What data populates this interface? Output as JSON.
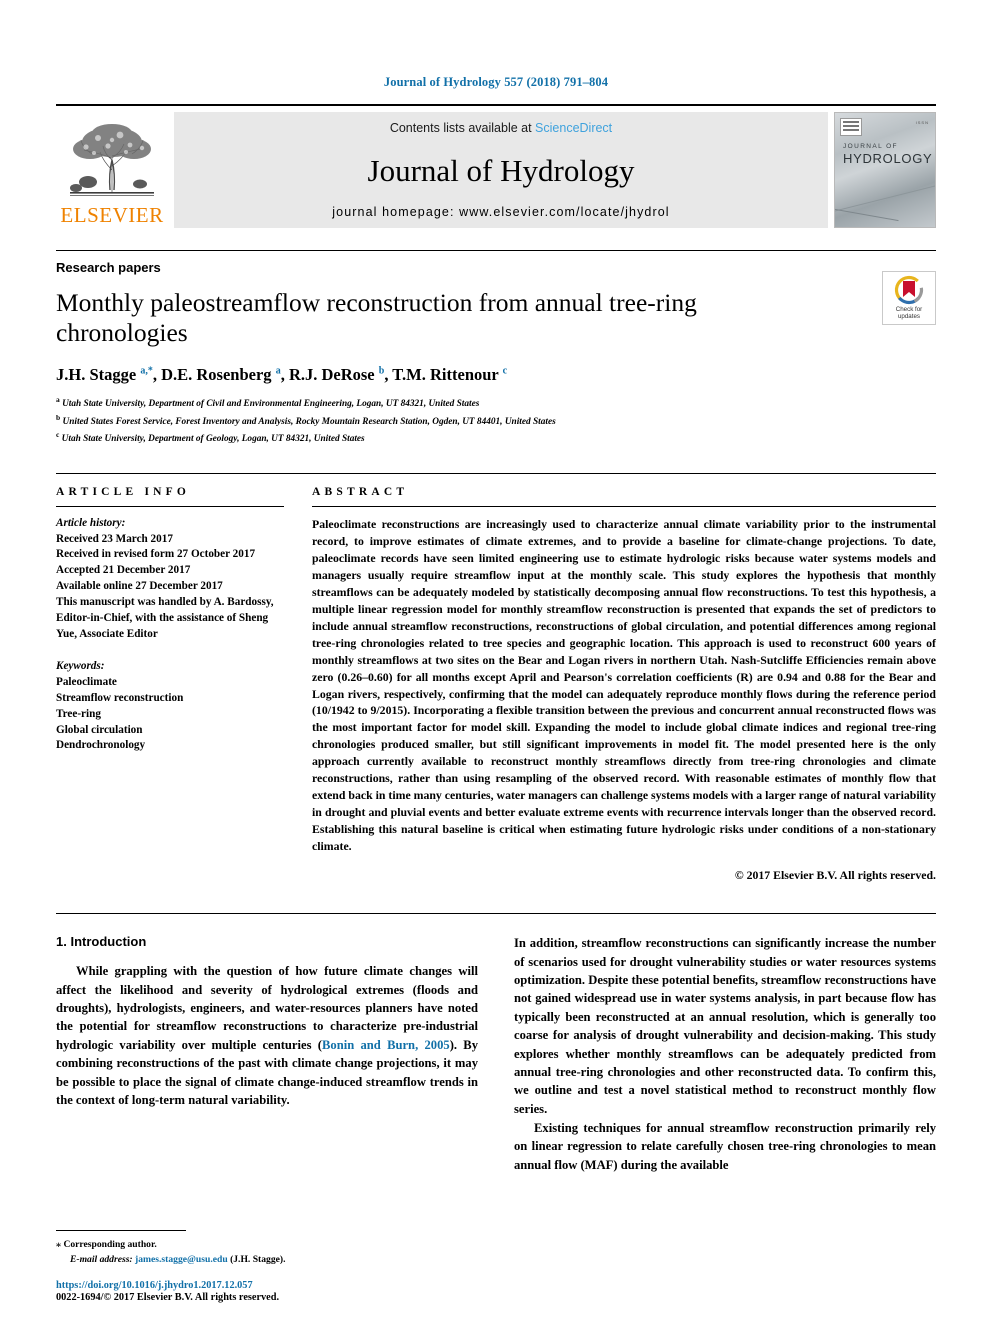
{
  "running_head": "Journal of Hydrology 557 (2018) 791–804",
  "masthead": {
    "publisher_name": "ELSEVIER",
    "contents_prefix": "Contents lists available at ",
    "contents_link": "ScienceDirect",
    "journal_title": "Journal of Hydrology",
    "homepage": "journal homepage: www.elsevier.com/locate/jhydrol",
    "cover": {
      "line1": "JOURNAL OF",
      "line2": "HYDROLOGY",
      "code": "ISSN"
    }
  },
  "article": {
    "kicker": "Research papers",
    "title": "Monthly paleostreamflow reconstruction from annual tree-ring chronologies",
    "authors_html": "J.H. Stagge <sup>a,*</sup>, D.E. Rosenberg <sup>a</sup>, R.J. DeRose <sup>b</sup>, T.M. Rittenour <sup>c</sup>",
    "affiliations": [
      {
        "marker": "a",
        "text": "Utah State University, Department of Civil and Environmental Engineering, Logan, UT 84321, United States"
      },
      {
        "marker": "b",
        "text": "United States Forest Service, Forest Inventory and Analysis, Rocky Mountain Research Station, Ogden, UT 84401, United States"
      },
      {
        "marker": "c",
        "text": "Utah State University, Department of Geology, Logan, UT 84321, United States"
      }
    ],
    "crossmark": {
      "line1": "Check for",
      "line2": "updates"
    }
  },
  "article_info": {
    "heading": "ARTICLE INFO",
    "history_label": "Article history:",
    "history": [
      "Received 23 March 2017",
      "Received in revised form 27 October 2017",
      "Accepted 21 December 2017",
      "Available online 27 December 2017",
      "This manuscript was handled by A. Bardossy, Editor-in-Chief, with the assistance of Sheng Yue, Associate Editor"
    ],
    "keywords_label": "Keywords:",
    "keywords": [
      "Paleoclimate",
      "Streamflow reconstruction",
      "Tree-ring",
      "Global circulation",
      "Dendrochronology"
    ]
  },
  "abstract": {
    "heading": "ABSTRACT",
    "text": "Paleoclimate reconstructions are increasingly used to characterize annual climate variability prior to the instrumental record, to improve estimates of climate extremes, and to provide a baseline for climate-change projections. To date, paleoclimate records have seen limited engineering use to estimate hydrologic risks because water systems models and managers usually require streamflow input at the monthly scale. This study explores the hypothesis that monthly streamflows can be adequately modeled by statistically decomposing annual flow reconstructions. To test this hypothesis, a multiple linear regression model for monthly streamflow reconstruction is presented that expands the set of predictors to include annual streamflow reconstructions, reconstructions of global circulation, and potential differences among regional tree-ring chronologies related to tree species and geographic location. This approach is used to reconstruct 600 years of monthly streamflows at two sites on the Bear and Logan rivers in northern Utah. Nash-Sutcliffe Efficiencies remain above zero (0.26–0.60) for all months except April and Pearson's correlation coefficients (R) are 0.94 and 0.88 for the Bear and Logan rivers, respectively, confirming that the model can adequately reproduce monthly flows during the reference period (10/1942 to 9/2015). Incorporating a flexible transition between the previous and concurrent annual reconstructed flows was the most important factor for model skill. Expanding the model to include global climate indices and regional tree-ring chronologies produced smaller, but still significant improvements in model fit. The model presented here is the only approach currently available to reconstruct monthly streamflows directly from tree-ring chronologies and climate reconstructions, rather than using resampling of the observed record. With reasonable estimates of monthly flow that extend back in time many centuries, water managers can challenge systems models with a larger range of natural variability in drought and pluvial events and better evaluate extreme events with recurrence intervals longer than the observed record. Establishing this natural baseline is critical when estimating future hydrologic risks under conditions of a non-stationary climate.",
    "copyright": "© 2017 Elsevier B.V. All rights reserved."
  },
  "body": {
    "section_title": "1. Introduction",
    "left_paragraph_1_pre": "While grappling with the question of how future climate changes will affect the likelihood and severity of hydrological extremes (floods and droughts), hydrologists, engineers, and water-resources planners have noted the potential for streamflow reconstructions to characterize pre-industrial hydrologic variability over multiple centuries (",
    "left_paragraph_1_ref": "Bonin and Burn, 2005",
    "left_paragraph_1_post": "). By combining reconstructions of the past with climate change projections, it may be possible to place the signal of climate change-induced streamflow trends in the context of long-term natural variability.",
    "right_paragraph_1": "In addition, streamflow reconstructions can significantly increase the number of scenarios used for drought vulnerability studies or water resources systems optimization. Despite these potential benefits, streamflow reconstructions have not gained widespread use in water systems analysis, in part because flow has typically been reconstructed at an annual resolution, which is generally too coarse for analysis of drought vulnerability and decision-making. This study explores whether monthly streamflows can be adequately predicted from annual tree-ring chronologies and other reconstructed data. To confirm this, we outline and test a novel statistical method to reconstruct monthly flow series.",
    "right_paragraph_2": "Existing techniques for annual streamflow reconstruction primarily rely on linear regression to relate carefully chosen tree-ring chronologies to mean annual flow (MAF) during the available"
  },
  "footnotes": {
    "corresponding_marker": "⁎",
    "corresponding_text": "Corresponding author.",
    "email_label": "E-mail address:",
    "email": "james.stagge@usu.edu",
    "email_suffix": "(J.H. Stagge).",
    "doi": "https://doi.org/10.1016/j.jhydro1.2017.12.057",
    "issn": "0022-1694/© 2017 Elsevier B.V. All rights reserved."
  },
  "colors": {
    "link_blue": "#1170a8",
    "sciencedirect_blue": "#3fa2dd",
    "elsevier_orange": "#ef8200",
    "crossmark_red": "#c8102e"
  }
}
